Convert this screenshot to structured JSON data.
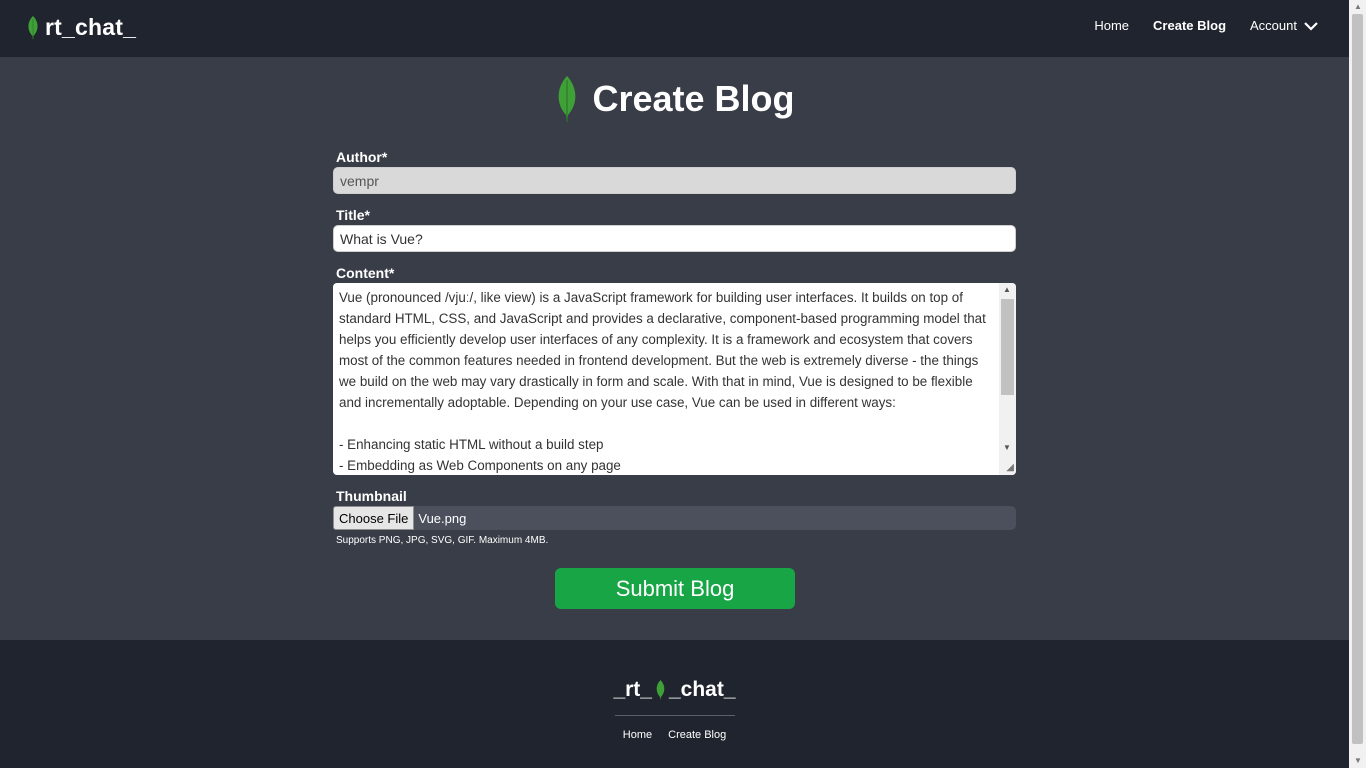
{
  "navbar": {
    "brand": "rt_chat_",
    "links": [
      "Home",
      "Create Blog",
      "Account"
    ]
  },
  "heading": {
    "title": "Create Blog"
  },
  "form": {
    "author_label": "Author*",
    "author_value": "vempr",
    "title_label": "Title*",
    "title_value": "What is Vue?",
    "content_label": "Content*",
    "content_value": "Vue (pronounced /vjuː/, like view) is a JavaScript framework for building user interfaces. It builds on top of standard HTML, CSS, and JavaScript and provides a declarative, component-based programming model that helps you efficiently develop user interfaces of any complexity. It is a framework and ecosystem that covers most of the common features needed in frontend development. But the web is extremely diverse - the things we build on the web may vary drastically in form and scale. With that in mind, Vue is designed to be flexible and incrementally adoptable. Depending on your use case, Vue can be used in different ways:\n\n- Enhancing static HTML without a build step\n- Embedding as Web Components on any page",
    "thumbnail_label": "Thumbnail",
    "file_button": "Choose File",
    "file_name": "Vue.png",
    "hint": "Supports PNG, JPG, SVG, GIF. Maximum 4MB.",
    "submit_label": "Submit Blog"
  },
  "footer": {
    "brand_left": "_rt_",
    "brand_right": "_chat_",
    "links": [
      "Home",
      "Create Blog"
    ]
  },
  "colors": {
    "nav_bg": "#1f242e",
    "page_bg": "#393d47",
    "accent_green": "#17a546",
    "leaf_green": "#3fa037"
  },
  "icons": [
    "leaf-icon",
    "chevron-down-icon"
  ]
}
